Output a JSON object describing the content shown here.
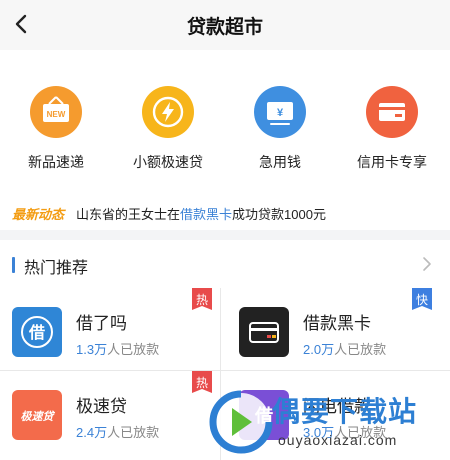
{
  "nav": {
    "title": "贷款超市"
  },
  "categories": [
    {
      "label": "新品速递",
      "icon": "new-tag-icon",
      "color": "#f59b2e",
      "icon_text": "NEW"
    },
    {
      "label": "小额极速贷",
      "icon": "lightning-icon",
      "color": "#f7b51b"
    },
    {
      "label": "急用钱",
      "icon": "cash-icon",
      "color": "#3f8fe0",
      "icon_text": "¥"
    },
    {
      "label": "信用卡专享",
      "icon": "credit-card-icon",
      "color": "#f0623f"
    }
  ],
  "news": {
    "tag": "最新动态",
    "before": "山东省的王女士在",
    "highlight": "借款黑卡",
    "after": "成功贷款1000元"
  },
  "hot": {
    "title": "热门推荐"
  },
  "products": [
    {
      "name": "借了吗",
      "count": "1.3万",
      "suffix": "人已放款",
      "badge": "热",
      "badge_color": "#e84b4b",
      "icon": "jielema-logo-icon",
      "icon_color": "#2f86d6",
      "icon_text": "借"
    },
    {
      "name": "借款黑卡",
      "count": "2.0万",
      "suffix": "人已放款",
      "badge": "快",
      "badge_color": "#3d7fe0",
      "icon": "black-card-icon",
      "icon_color": "#222222"
    },
    {
      "name": "极速贷",
      "count": "2.4万",
      "suffix": "人已放款",
      "badge": "热",
      "badge_color": "#e84b4b",
      "icon": "jisudai-logo-icon",
      "icon_color": "#f36b4b",
      "icon_text": "极速贷"
    },
    {
      "name": "闪电借款",
      "count": "3.0万",
      "suffix": "人已放款",
      "icon": "lightning-loan-logo-icon",
      "icon_color": "#7a4fd6",
      "icon_text": "借"
    }
  ],
  "watermark": {
    "text": "偶要下载站",
    "url": "ouyaoxiazai.com"
  }
}
